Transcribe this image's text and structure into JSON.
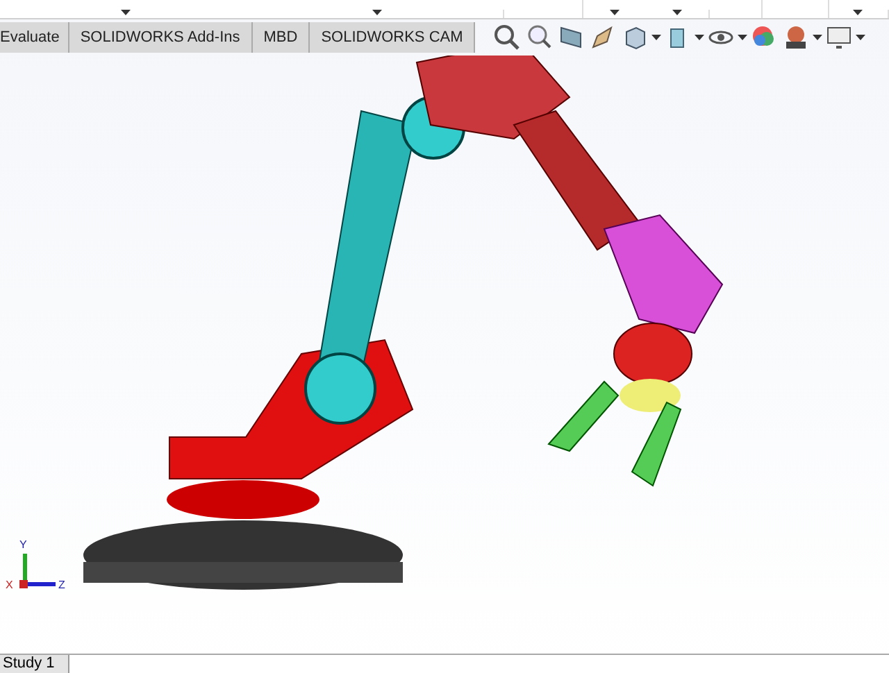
{
  "tabs": [
    {
      "label": "Evaluate",
      "selected": false
    },
    {
      "label": "SOLIDWORKS Add-Ins",
      "selected": false
    },
    {
      "label": "MBD",
      "selected": false
    },
    {
      "label": "SOLIDWORKS CAM",
      "selected": false
    }
  ],
  "triad": {
    "y": "Y",
    "z": "Z",
    "x": "X"
  },
  "bottom_tabs": [
    {
      "label": "Study 1",
      "selected": true
    }
  ]
}
